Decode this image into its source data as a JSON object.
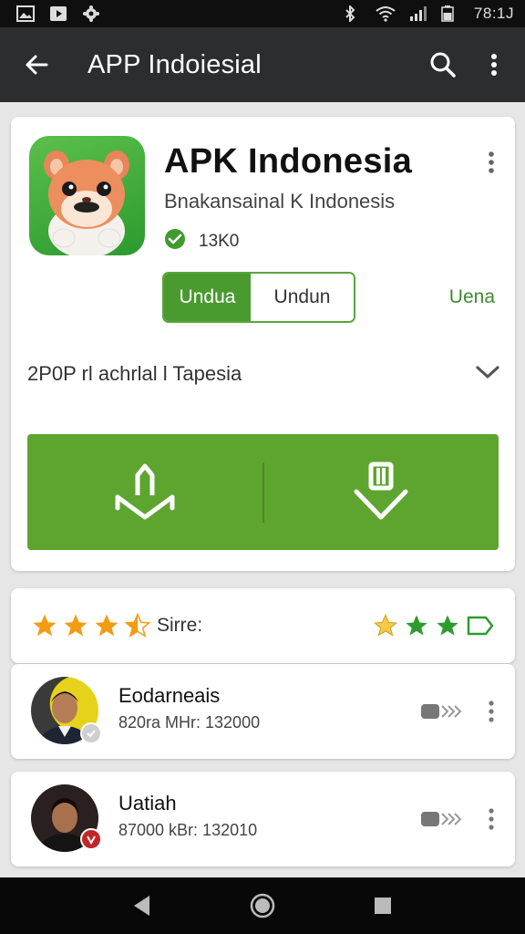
{
  "status_bar": {
    "time": "78:1J",
    "icons": [
      "image-icon",
      "play-store-icon",
      "settings-gear-icon",
      "bluetooth-icon",
      "wifi-icon",
      "signal-icon",
      "battery-icon"
    ]
  },
  "app_bar": {
    "title": "APP Indoiesial",
    "icons": [
      "back-arrow-icon",
      "search-icon",
      "more-vert-icon"
    ]
  },
  "app": {
    "name": "APK Indonesia",
    "subtitle": "Bnakansainal K Indonesis",
    "verified_text": "13K0",
    "tab_active": "Undua",
    "tab_inactive": "Undun",
    "link": "Uena",
    "description": "2P0P rl achrlal l Tapesia",
    "actions": [
      "upload-icon",
      "download-icon"
    ]
  },
  "rating": {
    "label": "Sirre:",
    "left_stars": 3.5,
    "right_icons": [
      "star-half-icon",
      "star-icon",
      "star-icon",
      "tag-icon"
    ]
  },
  "users": [
    {
      "name": "Eodarneais",
      "meta": "820ra MHr: 132000",
      "badge": "check"
    },
    {
      "name": "Uatiah",
      "meta": "87000 kBr: 132010",
      "badge": "v"
    }
  ],
  "colors": {
    "appbar": "#2b2d2f",
    "green_accent": "#5ea52f",
    "star": "#f39c12",
    "star_green": "#2e9b2e"
  },
  "nav": [
    "back-triangle-icon",
    "home-circle-icon",
    "recents-square-icon"
  ]
}
